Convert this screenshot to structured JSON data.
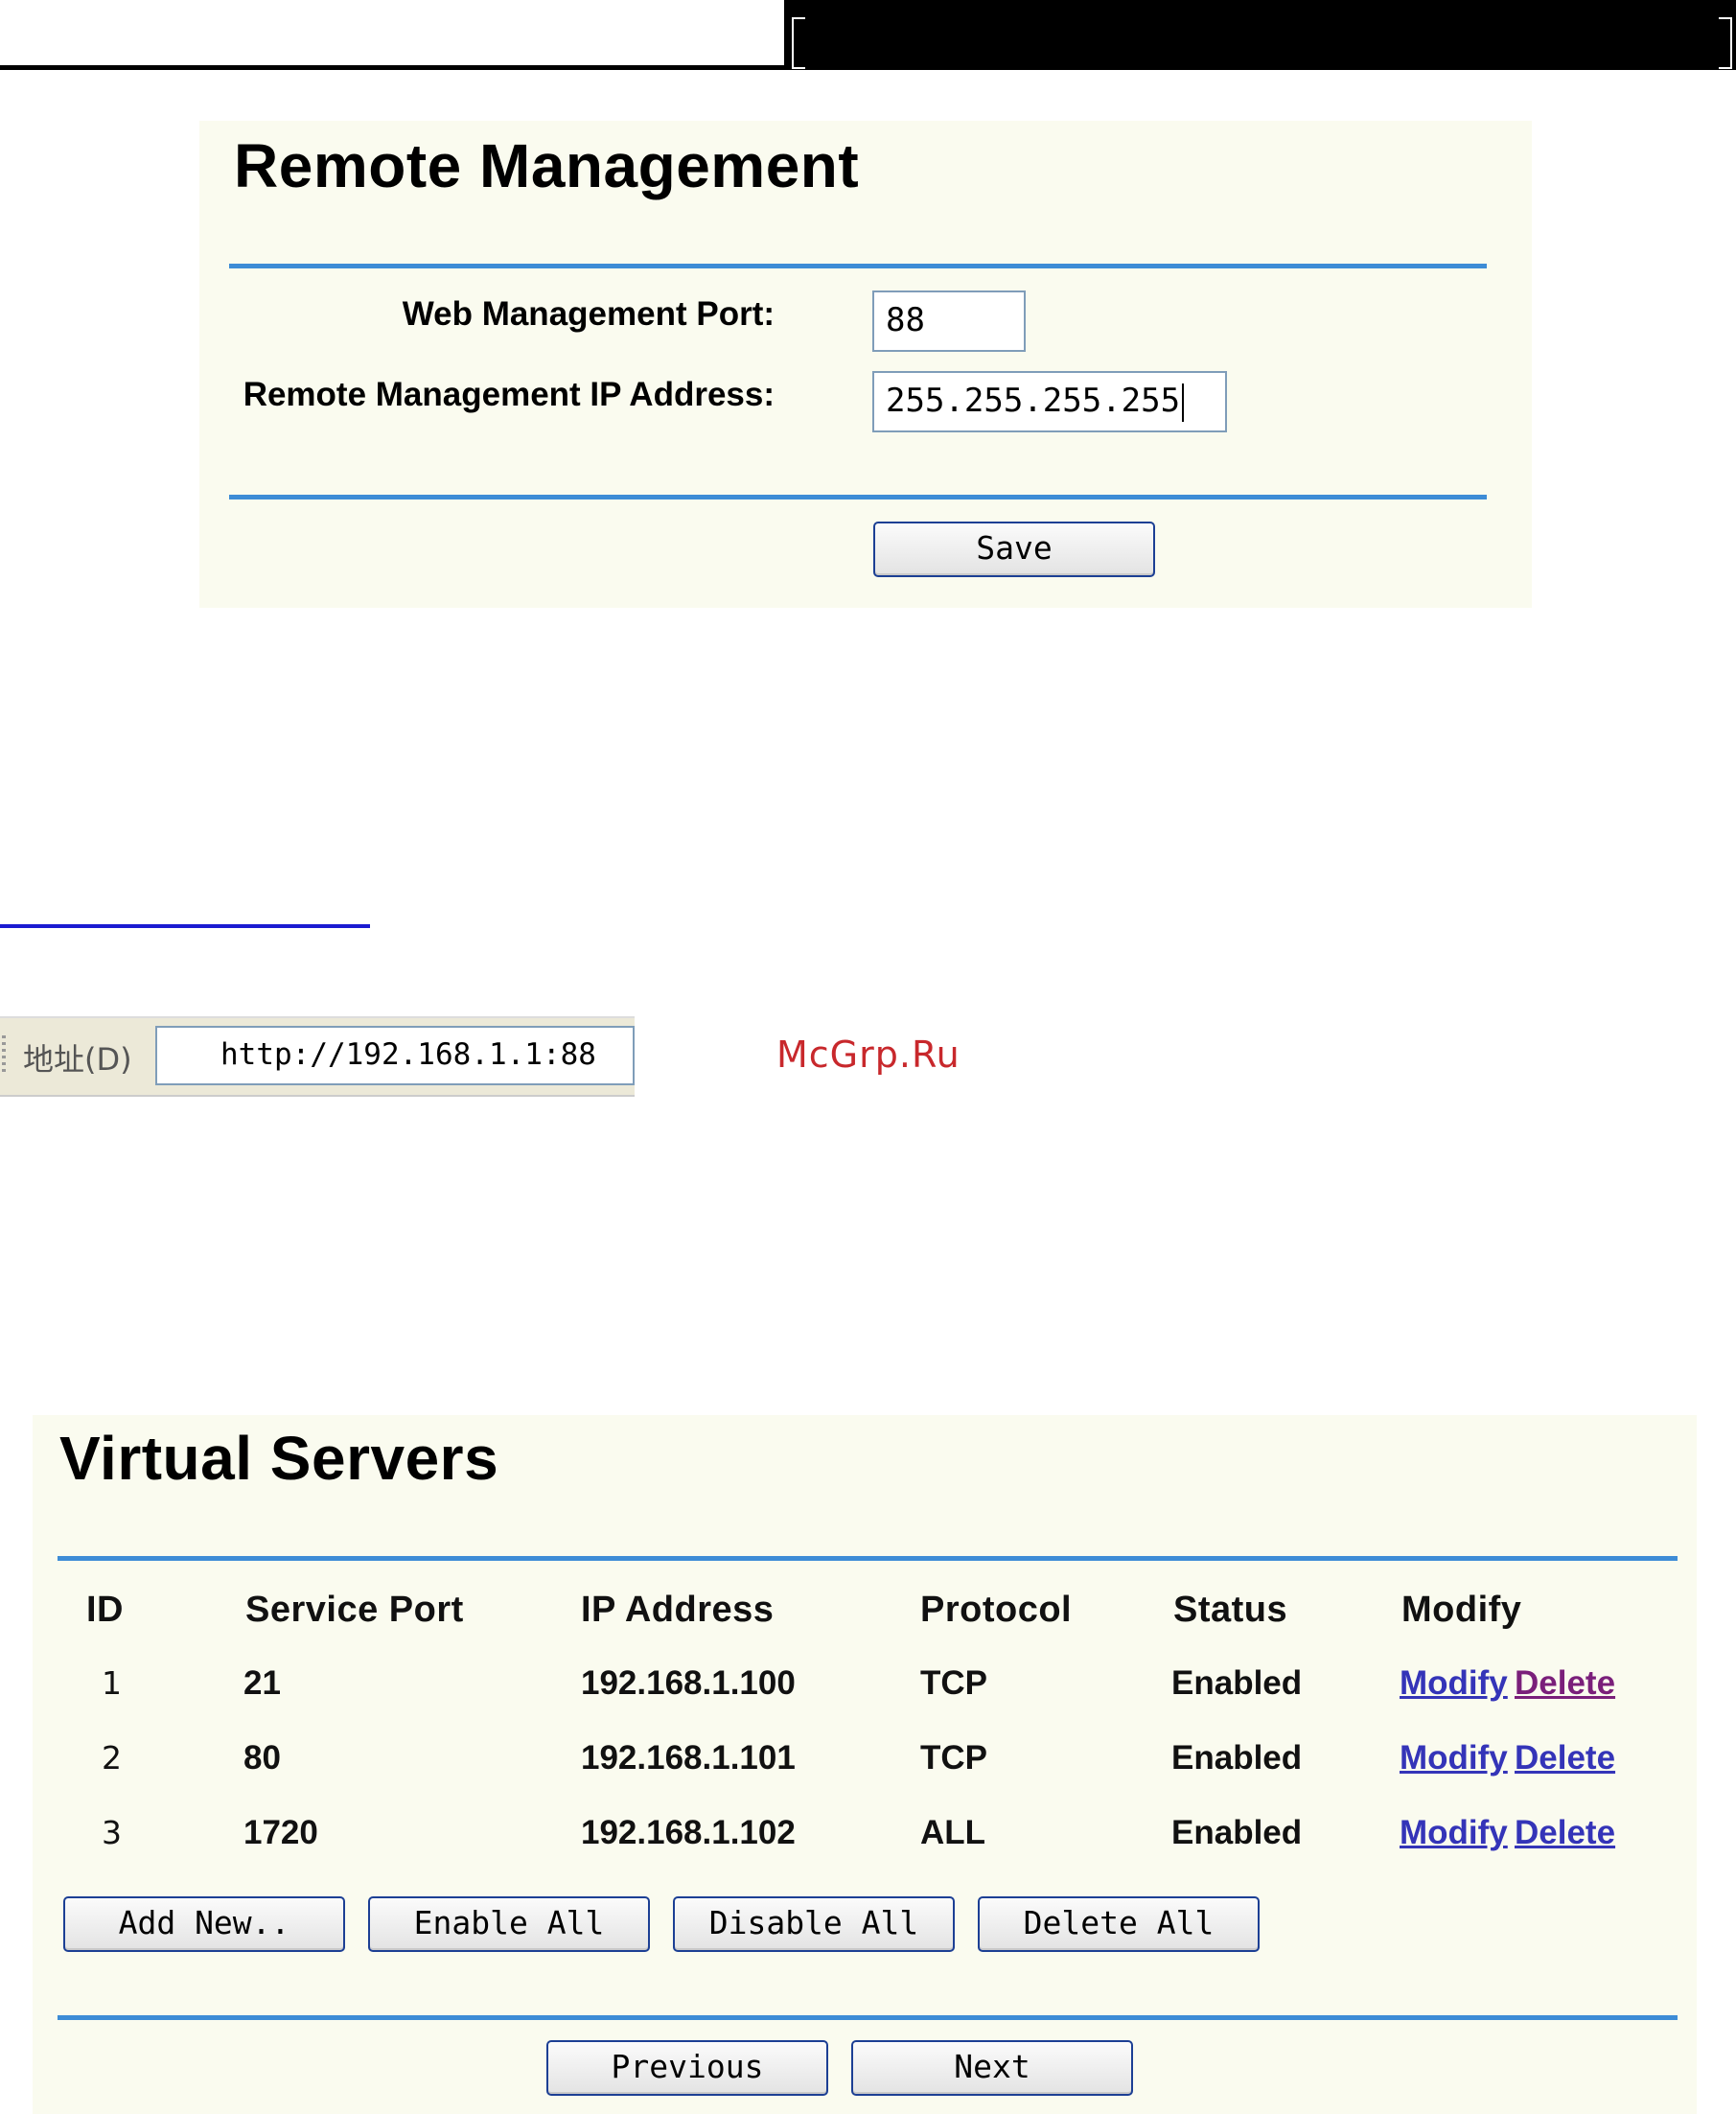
{
  "remote_management": {
    "title": "Remote Management",
    "web_port_label": "Web Management Port:",
    "web_port_value": "88",
    "ip_label": "Remote Management IP Address:",
    "ip_value": "255.255.255.255",
    "save_label": "Save"
  },
  "address_bar": {
    "label": "地址(D)",
    "url": "http://192.168.1.1:88"
  },
  "watermark": "McGrp.Ru",
  "virtual_servers": {
    "title": "Virtual Servers",
    "columns": [
      "ID",
      "Service Port",
      "IP Address",
      "Protocol",
      "Status",
      "Modify"
    ],
    "rows": [
      {
        "id": "1",
        "port": "21",
        "ip": "192.168.1.100",
        "protocol": "TCP",
        "status": "Enabled",
        "modify": "Modify",
        "delete": "Delete"
      },
      {
        "id": "2",
        "port": "80",
        "ip": "192.168.1.101",
        "protocol": "TCP",
        "status": "Enabled",
        "modify": "Modify",
        "delete": "Delete"
      },
      {
        "id": "3",
        "port": "1720",
        "ip": "192.168.1.102",
        "protocol": "ALL",
        "status": "Enabled",
        "modify": "Modify",
        "delete": "Delete"
      }
    ],
    "buttons": {
      "add_new": "Add New..",
      "enable_all": "Enable All",
      "disable_all": "Disable All",
      "delete_all": "Delete All",
      "previous": "Previous",
      "next": "Next"
    }
  },
  "colors": {
    "panel_bg": "#fafbef",
    "rule": "#3d8cd6",
    "link": "#3434b8",
    "visited_link": "#7a1f7a",
    "watermark": "#c8282c"
  }
}
